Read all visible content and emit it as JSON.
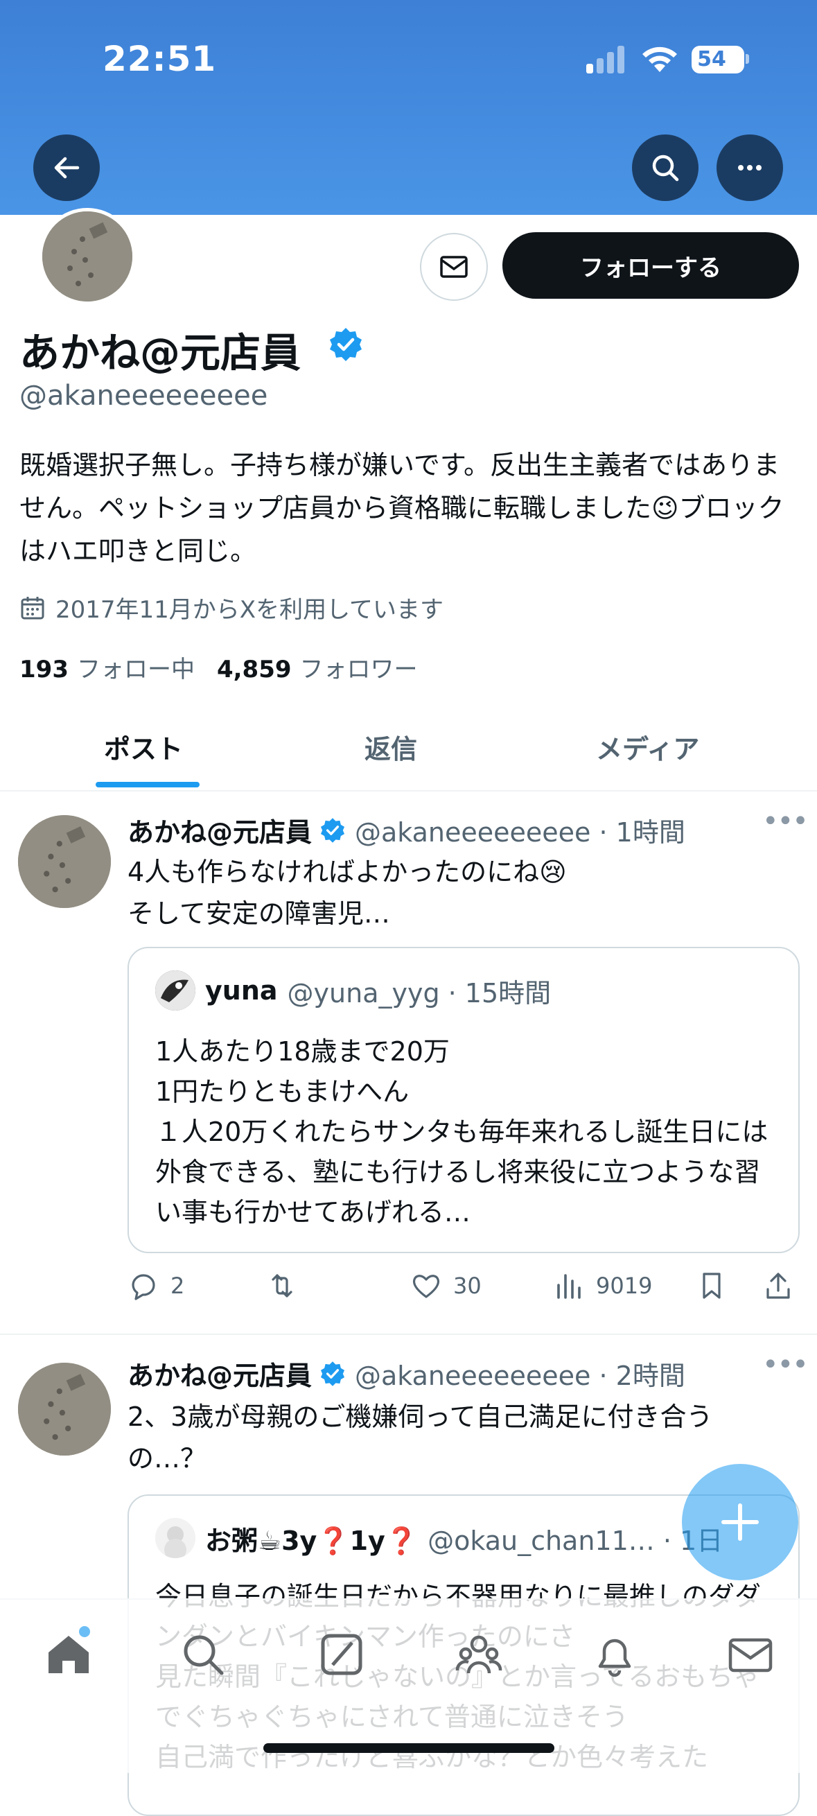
{
  "status_bar": {
    "time": "22:51",
    "battery": "54"
  },
  "profile": {
    "name": "あかね@元店員",
    "handle": "@akaneeeeeeeee",
    "bio": "既婚選択子無し。子持ち様が嫌いです。反出生主義者ではありません。ペットショップ店員から資格職に転職しました😉ブロックはハエ叩きと同じ。",
    "joined": "2017年11月からXを利用しています",
    "following_count": "193",
    "following_label": "フォロー中",
    "followers_count": "4,859",
    "followers_label": "フォロワー",
    "follow_button": "フォローする"
  },
  "tabs": [
    {
      "label": "ポスト"
    },
    {
      "label": "返信"
    },
    {
      "label": "メディア"
    }
  ],
  "posts": [
    {
      "name": "あかね@元店員",
      "meta": "@akaneeeeeeeee · 1時間",
      "text_line1": "4人も作らなければよかったのにね😢",
      "text_line2": "そして安定の障害児…",
      "quote": {
        "name": "yuna",
        "meta": "@yuna_yyg · 15時間",
        "text": "1人あたり18歳まで20万\n1円たりともまけへん\n１人20万くれたらサンタも毎年来れるし誕生日には外食できる、塾にも行けるし将来役に立つような習い事も行かせてあげれる…"
      },
      "replies": "2",
      "reposts": "",
      "likes": "30",
      "views": "9019"
    },
    {
      "name": "あかね@元店員",
      "meta": "@akaneeeeeeeee · 2時間",
      "text": "2、3歳が母親のご機嫌伺って自己満足に付き合うの…？",
      "quote": {
        "name": "お粥☕3y❓1y❓",
        "meta": "@okau_chan11… · 1日",
        "text": "今日息子の誕生日だから不器用なりに最推しのダダンダンとバイキンマン作ったのにさ\n見た瞬間『これじゃないの』とか言ってるおもちゃでぐちゃぐちゃにされて普通に泣きそう\n自己満で作ったけど喜ぶかな？とか色々考えた"
      }
    }
  ],
  "colors": {
    "header": "#3d80d6",
    "accent": "#1d9bf0",
    "text": "#0f1419",
    "secondary": "#536471"
  }
}
